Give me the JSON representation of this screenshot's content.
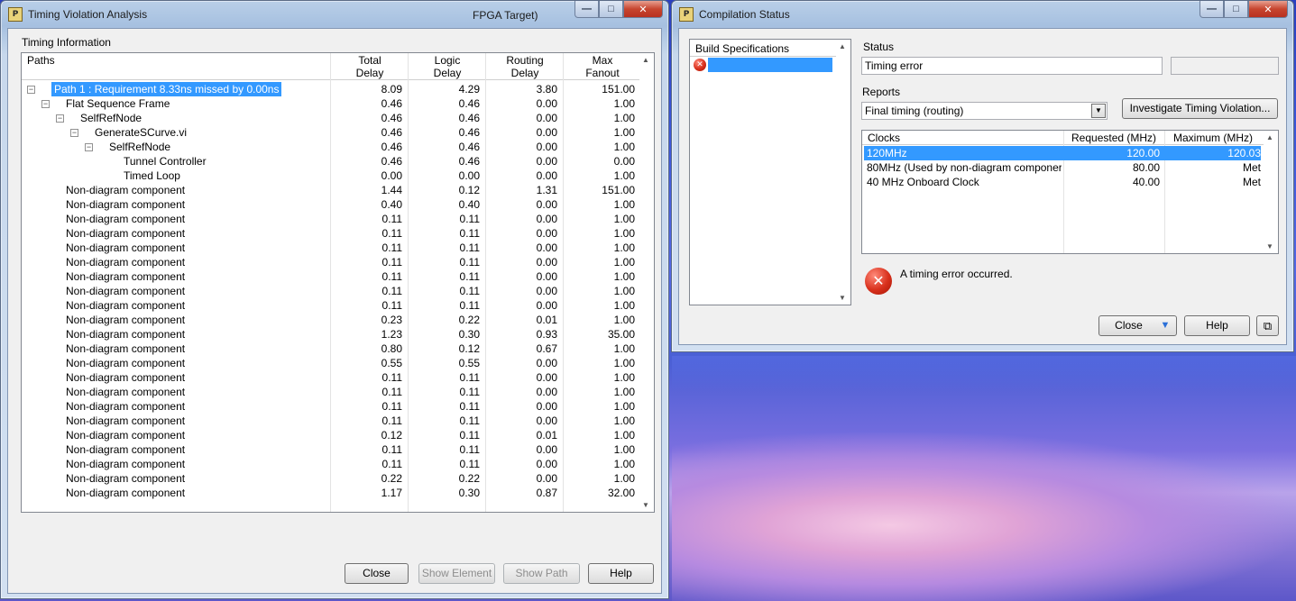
{
  "timing_window": {
    "title": "Timing Violation Analysis",
    "title_extra": "FPGA Target)",
    "group_label": "Timing Information",
    "columns": {
      "paths": "Paths",
      "total_delay": [
        "Total",
        "Delay"
      ],
      "logic_delay": [
        "Logic",
        "Delay"
      ],
      "routing_delay": [
        "Routing",
        "Delay"
      ],
      "max_fanout": [
        "Max",
        "Fanout"
      ]
    },
    "rows": [
      {
        "name": "Path 1 : Requirement 8.33ns missed by 0.00ns",
        "indent": 0,
        "expander": true,
        "selected": true,
        "total": "8.09",
        "logic": "4.29",
        "routing": "3.80",
        "fanout": "151.00"
      },
      {
        "name": "Flat Sequence Frame",
        "indent": 1,
        "expander": true,
        "total": "0.46",
        "logic": "0.46",
        "routing": "0.00",
        "fanout": "1.00"
      },
      {
        "name": "SelfRefNode",
        "indent": 2,
        "expander": true,
        "total": "0.46",
        "logic": "0.46",
        "routing": "0.00",
        "fanout": "1.00"
      },
      {
        "name": "GenerateSCurve.vi",
        "indent": 3,
        "expander": true,
        "total": "0.46",
        "logic": "0.46",
        "routing": "0.00",
        "fanout": "1.00"
      },
      {
        "name": "SelfRefNode",
        "indent": 4,
        "expander": true,
        "total": "0.46",
        "logic": "0.46",
        "routing": "0.00",
        "fanout": "1.00"
      },
      {
        "name": "Tunnel Controller",
        "indent": 5,
        "expander": false,
        "total": "0.46",
        "logic": "0.46",
        "routing": "0.00",
        "fanout": "0.00"
      },
      {
        "name": "Timed Loop",
        "indent": 5,
        "expander": false,
        "total": "0.00",
        "logic": "0.00",
        "routing": "0.00",
        "fanout": "1.00"
      },
      {
        "name": "Non-diagram component",
        "indent": 1,
        "expander": false,
        "total": "1.44",
        "logic": "0.12",
        "routing": "1.31",
        "fanout": "151.00"
      },
      {
        "name": "Non-diagram component",
        "indent": 1,
        "expander": false,
        "total": "0.40",
        "logic": "0.40",
        "routing": "0.00",
        "fanout": "1.00"
      },
      {
        "name": "Non-diagram component",
        "indent": 1,
        "expander": false,
        "total": "0.11",
        "logic": "0.11",
        "routing": "0.00",
        "fanout": "1.00"
      },
      {
        "name": "Non-diagram component",
        "indent": 1,
        "expander": false,
        "total": "0.11",
        "logic": "0.11",
        "routing": "0.00",
        "fanout": "1.00"
      },
      {
        "name": "Non-diagram component",
        "indent": 1,
        "expander": false,
        "total": "0.11",
        "logic": "0.11",
        "routing": "0.00",
        "fanout": "1.00"
      },
      {
        "name": "Non-diagram component",
        "indent": 1,
        "expander": false,
        "total": "0.11",
        "logic": "0.11",
        "routing": "0.00",
        "fanout": "1.00"
      },
      {
        "name": "Non-diagram component",
        "indent": 1,
        "expander": false,
        "total": "0.11",
        "logic": "0.11",
        "routing": "0.00",
        "fanout": "1.00"
      },
      {
        "name": "Non-diagram component",
        "indent": 1,
        "expander": false,
        "total": "0.11",
        "logic": "0.11",
        "routing": "0.00",
        "fanout": "1.00"
      },
      {
        "name": "Non-diagram component",
        "indent": 1,
        "expander": false,
        "total": "0.11",
        "logic": "0.11",
        "routing": "0.00",
        "fanout": "1.00"
      },
      {
        "name": "Non-diagram component",
        "indent": 1,
        "expander": false,
        "total": "0.23",
        "logic": "0.22",
        "routing": "0.01",
        "fanout": "1.00"
      },
      {
        "name": "Non-diagram component",
        "indent": 1,
        "expander": false,
        "total": "1.23",
        "logic": "0.30",
        "routing": "0.93",
        "fanout": "35.00"
      },
      {
        "name": "Non-diagram component",
        "indent": 1,
        "expander": false,
        "total": "0.80",
        "logic": "0.12",
        "routing": "0.67",
        "fanout": "1.00"
      },
      {
        "name": "Non-diagram component",
        "indent": 1,
        "expander": false,
        "total": "0.55",
        "logic": "0.55",
        "routing": "0.00",
        "fanout": "1.00"
      },
      {
        "name": "Non-diagram component",
        "indent": 1,
        "expander": false,
        "total": "0.11",
        "logic": "0.11",
        "routing": "0.00",
        "fanout": "1.00"
      },
      {
        "name": "Non-diagram component",
        "indent": 1,
        "expander": false,
        "total": "0.11",
        "logic": "0.11",
        "routing": "0.00",
        "fanout": "1.00"
      },
      {
        "name": "Non-diagram component",
        "indent": 1,
        "expander": false,
        "total": "0.11",
        "logic": "0.11",
        "routing": "0.00",
        "fanout": "1.00"
      },
      {
        "name": "Non-diagram component",
        "indent": 1,
        "expander": false,
        "total": "0.11",
        "logic": "0.11",
        "routing": "0.00",
        "fanout": "1.00"
      },
      {
        "name": "Non-diagram component",
        "indent": 1,
        "expander": false,
        "total": "0.12",
        "logic": "0.11",
        "routing": "0.01",
        "fanout": "1.00"
      },
      {
        "name": "Non-diagram component",
        "indent": 1,
        "expander": false,
        "total": "0.11",
        "logic": "0.11",
        "routing": "0.00",
        "fanout": "1.00"
      },
      {
        "name": "Non-diagram component",
        "indent": 1,
        "expander": false,
        "total": "0.11",
        "logic": "0.11",
        "routing": "0.00",
        "fanout": "1.00"
      },
      {
        "name": "Non-diagram component",
        "indent": 1,
        "expander": false,
        "total": "0.22",
        "logic": "0.22",
        "routing": "0.00",
        "fanout": "1.00"
      },
      {
        "name": "Non-diagram component",
        "indent": 1,
        "expander": false,
        "total": "1.17",
        "logic": "0.30",
        "routing": "0.87",
        "fanout": "32.00"
      }
    ],
    "buttons": {
      "close": "Close",
      "show_element": "Show Element",
      "show_path": "Show Path",
      "help": "Help"
    }
  },
  "compilation_window": {
    "title": "Compilation Status",
    "build_specs_label": "Build Specifications",
    "status_label": "Status",
    "status_value": "Timing error",
    "reports_label": "Reports",
    "reports_value": "Final timing (routing)",
    "investigate_button": "Investigate Timing Violation...",
    "clocks_header": {
      "clocks": "Clocks",
      "requested": "Requested (MHz)",
      "maximum": "Maximum (MHz)"
    },
    "clocks": [
      {
        "name": "120MHz",
        "requested": "120.00",
        "maximum": "120.03",
        "selected": true
      },
      {
        "name": "80MHz (Used by non-diagram componer",
        "requested": "80.00",
        "maximum": "Met"
      },
      {
        "name": "40 MHz Onboard Clock",
        "requested": "40.00",
        "maximum": "Met"
      }
    ],
    "error_message": "A timing error occurred.",
    "close_button": "Close",
    "help_button": "Help"
  },
  "icons": {
    "app": "labview-fpga-icon",
    "error": "error-x-icon",
    "minimize": "minimize-icon",
    "maximize": "maximize-icon",
    "close": "close-icon"
  },
  "colors": {
    "selection": "#3399ff",
    "error_red": "#d8301c",
    "window_frame": "#b9cfe8"
  }
}
